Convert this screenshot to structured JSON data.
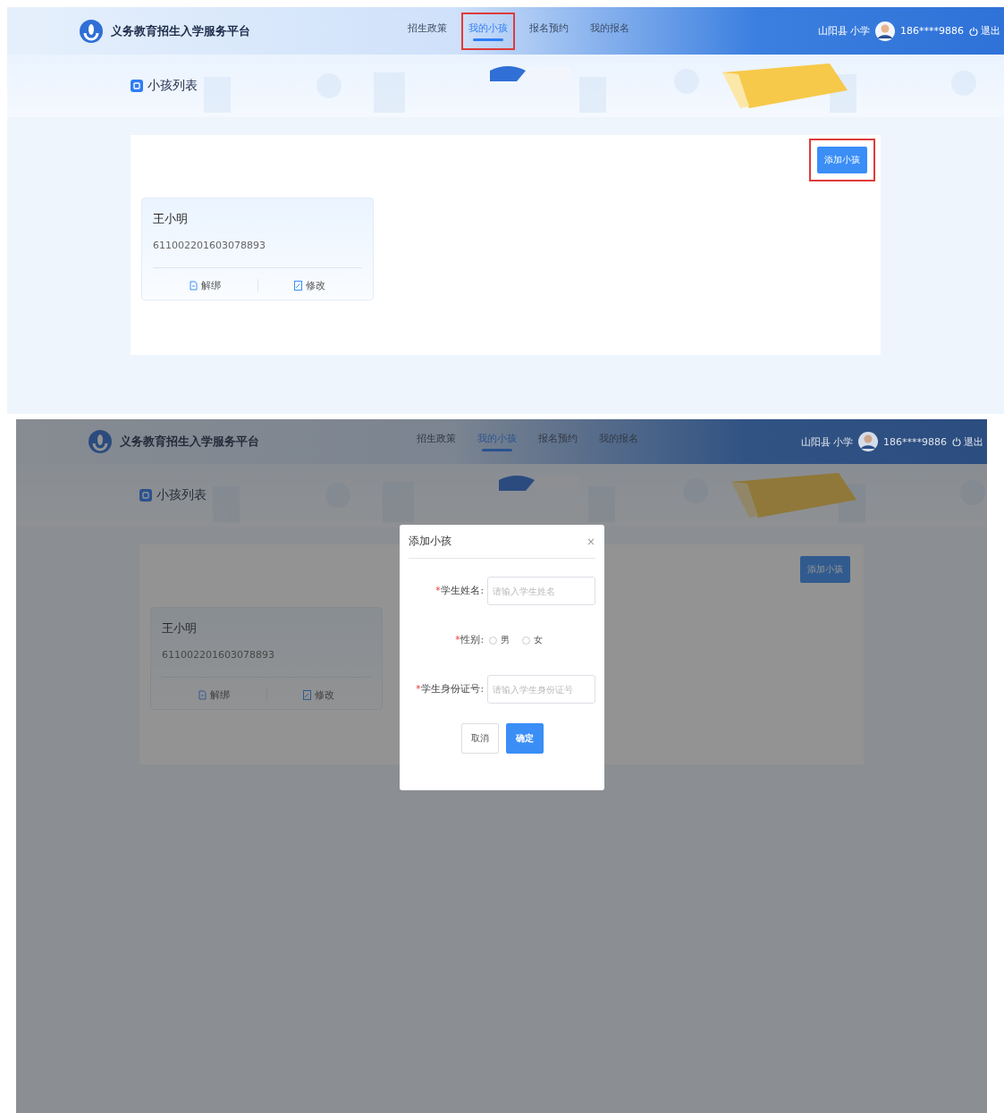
{
  "screens": [
    {
      "header": {
        "title": "义务教育招生入学服务平台",
        "nav": [
          {
            "label": "招生政策",
            "selected": false,
            "highlighted": false
          },
          {
            "label": "我的小孩",
            "selected": true,
            "highlighted": true
          },
          {
            "label": "报名预约",
            "selected": false,
            "highlighted": false
          },
          {
            "label": "我的报名",
            "selected": false,
            "highlighted": false
          }
        ],
        "school": "山阳县 小学",
        "phone": "186****9886",
        "logout": "退出"
      },
      "page_title": "小孩列表",
      "add_button": {
        "label": "添加小孩",
        "highlighted": true
      },
      "children": [
        {
          "name": "王小明",
          "id_number": "611002201603078893",
          "actions": [
            {
              "kind": "unbind",
              "label": "解绑"
            },
            {
              "kind": "edit",
              "label": "修改"
            }
          ]
        }
      ]
    },
    {
      "header": {
        "title": "义务教育招生入学服务平台",
        "nav": [
          {
            "label": "招生政策",
            "selected": false,
            "highlighted": false
          },
          {
            "label": "我的小孩",
            "selected": true,
            "highlighted": false
          },
          {
            "label": "报名预约",
            "selected": false,
            "highlighted": false
          },
          {
            "label": "我的报名",
            "selected": false,
            "highlighted": false
          }
        ],
        "school": "山阳县 小学",
        "phone": "186****9886",
        "logout": "退出"
      },
      "page_title": "小孩列表",
      "add_button": {
        "label": "添加小孩",
        "highlighted": false
      },
      "children": [
        {
          "name": "王小明",
          "id_number": "611002201603078893",
          "actions": [
            {
              "kind": "unbind",
              "label": "解绑"
            },
            {
              "kind": "edit",
              "label": "修改"
            }
          ]
        }
      ],
      "modal": {
        "title": "添加小孩",
        "close": "×",
        "fields": [
          {
            "kind": "text",
            "required_mark": "*",
            "label": "学生姓名:",
            "placeholder": "请输入学生姓名"
          },
          {
            "kind": "radio",
            "required_mark": "*",
            "label": "性别:",
            "options": [
              {
                "label": "男",
                "selected": false
              },
              {
                "label": "女",
                "selected": false
              }
            ]
          },
          {
            "kind": "text",
            "required_mark": "*",
            "label": "学生身份证号:",
            "placeholder": "请输入学生身份证号"
          }
        ],
        "buttons": [
          {
            "kind": "cancel",
            "label": "取消"
          },
          {
            "kind": "primary",
            "label": "确定"
          }
        ]
      }
    }
  ]
}
